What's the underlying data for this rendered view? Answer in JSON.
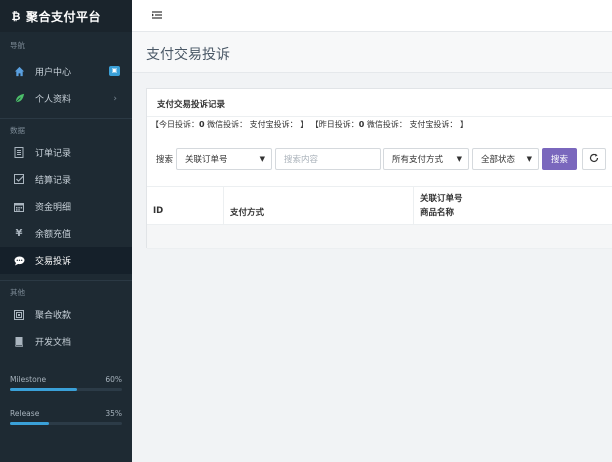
{
  "brand": {
    "logo_glyph": "₿",
    "title": "聚合支付平台"
  },
  "sidebar": {
    "section_nav": "导航",
    "nav": [
      {
        "label": "用户中心",
        "icon": "home-icon",
        "badge": "▣"
      },
      {
        "label": "个人资料",
        "icon": "leaf-icon",
        "chevron": "›"
      }
    ],
    "section_data": "数据",
    "data_items": [
      {
        "label": "订单记录",
        "icon": "list-icon"
      },
      {
        "label": "结算记录",
        "icon": "check-square-icon"
      },
      {
        "label": "资金明细",
        "icon": "calendar-icon"
      },
      {
        "label": "余额充值",
        "icon": "yen-icon"
      },
      {
        "label": "交易投诉",
        "icon": "comment-icon",
        "active": true
      }
    ],
    "section_other": "其他",
    "other_items": [
      {
        "label": "聚合收款",
        "icon": "qrcode-icon"
      },
      {
        "label": "开发文档",
        "icon": "book-icon"
      }
    ],
    "progress": [
      {
        "label": "Milestone",
        "value": "60%",
        "fraction": 0.6
      },
      {
        "label": "Release",
        "value": "35%",
        "fraction": 0.35
      }
    ]
  },
  "topbar": {
    "menu_icon": "menu-toggle-icon"
  },
  "page": {
    "title": "支付交易投诉"
  },
  "card": {
    "title": "支付交易投诉记录",
    "summary": {
      "today_prefix": "【今日投诉：",
      "today_count": "0",
      "today_wechat": "微信投诉：",
      "today_alipay": "支付宝投诉：",
      "today_suffix": "】",
      "yesterday_prefix": "【昨日投诉：",
      "yesterday_count": "0",
      "yesterday_wechat": "微信投诉：",
      "yesterday_alipay": "支付宝投诉：",
      "yesterday_suffix": "】"
    },
    "filters": {
      "label": "搜索",
      "field_select": "关联订单号",
      "search_placeholder": "搜索内容",
      "paytype_select": "所有支付方式",
      "status_select": "全部状态",
      "search_button": "搜索"
    },
    "table": {
      "col_id": "ID",
      "col_paytype": "支付方式",
      "col_order_line1": "关联订单号",
      "col_order_line2": "商品名称"
    }
  },
  "colors": {
    "sidebar_bg": "#1e2a33",
    "accent": "#7a67bd",
    "progress": "#3aa0d8"
  }
}
